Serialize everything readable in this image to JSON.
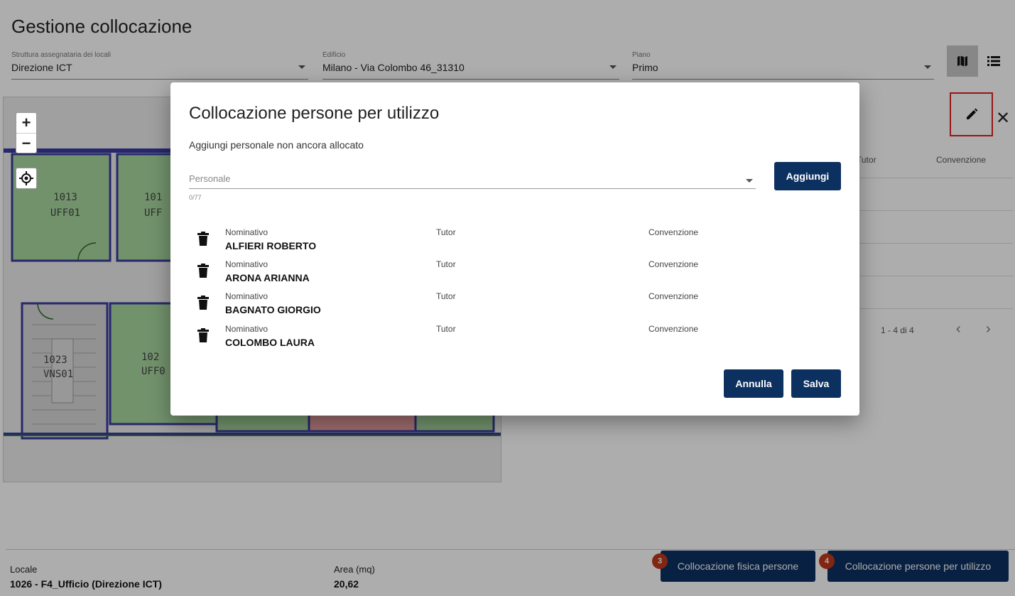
{
  "page": {
    "title": "Gestione collocazione",
    "filters": [
      {
        "label": "Struttura assegnataria dei locali",
        "value": "Direzione ICT"
      },
      {
        "label": "Edificio",
        "value": "Milano - Via Colombo 46_31310"
      },
      {
        "label": "Piano",
        "value": "Primo"
      }
    ],
    "view_toggle": {
      "map_icon": "map-icon",
      "list_icon": "list-icon",
      "active": "map"
    }
  },
  "map": {
    "zoom_in": "+",
    "zoom_out": "−",
    "rooms": [
      {
        "number": "1013",
        "code": "UFF01"
      },
      {
        "number": "101",
        "code": "UFF"
      },
      {
        "number": "1023",
        "code": "VNS01"
      },
      {
        "number": "102",
        "code": "UFF0"
      }
    ]
  },
  "right_panel": {
    "col_tutor": "Tutor",
    "col_convenzione": "Convenzione",
    "pager": "1 - 4 di 4",
    "prev": "‹",
    "next": "›",
    "close": "✕"
  },
  "footer": {
    "locale_label": "Locale",
    "locale_value": "1026 - F4_Ufficio (Direzione ICT)",
    "area_label": "Area (mq)",
    "area_value": "20,62",
    "buttons": [
      {
        "label": "Collocazione fisica persone",
        "badge": "3"
      },
      {
        "label": "Collocazione persone per utilizzo",
        "badge": "4"
      }
    ]
  },
  "dialog": {
    "title": "Collocazione persone per utilizzo",
    "subtitle": "Aggiungi personale non ancora allocato",
    "personale_placeholder": "Personale",
    "counter": "0/77",
    "add_button": "Aggiungi",
    "col_nominativo": "Nominativo",
    "col_tutor": "Tutor",
    "col_convenzione": "Convenzione",
    "people": [
      {
        "name": "ALFIERI ROBERTO"
      },
      {
        "name": "ARONA ARIANNA"
      },
      {
        "name": "BAGNATO GIORGIO"
      },
      {
        "name": "COLOMBO LAURA"
      }
    ],
    "cancel_button": "Annulla",
    "save_button": "Salva"
  },
  "colors": {
    "primary": "#0c3060",
    "badge": "#c0391b",
    "highlight_border": "#e02020",
    "room_green": "#a8d8a0",
    "room_red": "#e8a0a0",
    "wall": "#3a3aa0"
  }
}
